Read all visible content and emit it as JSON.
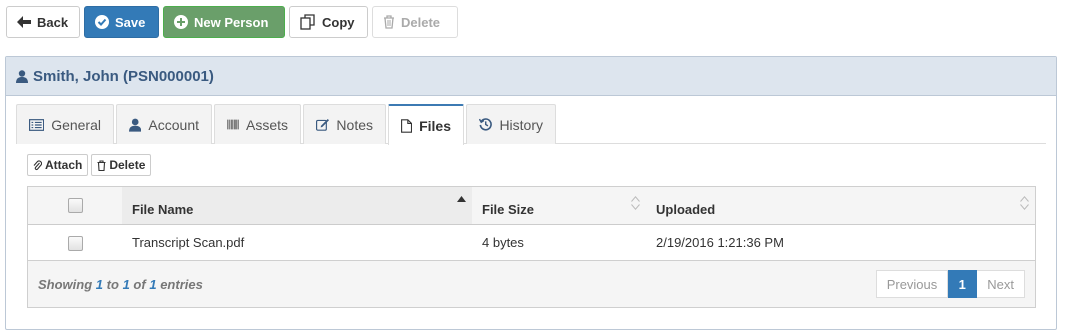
{
  "toolbar": {
    "back_label": "Back",
    "save_label": "Save",
    "new_person_label": "New Person",
    "copy_label": "Copy",
    "delete_label": "Delete"
  },
  "record": {
    "title": "Smith, John (PSN000001)"
  },
  "tabs": [
    {
      "label": "General",
      "icon": "list-icon"
    },
    {
      "label": "Account",
      "icon": "user-icon"
    },
    {
      "label": "Assets",
      "icon": "barcode-icon"
    },
    {
      "label": "Notes",
      "icon": "edit-icon"
    },
    {
      "label": "Files",
      "icon": "file-icon",
      "active": true
    },
    {
      "label": "History",
      "icon": "history-icon"
    }
  ],
  "files": {
    "attach_label": "Attach",
    "delete_label": "Delete",
    "columns": [
      "File Name",
      "File Size",
      "Uploaded"
    ],
    "sort": {
      "column": "File Name",
      "direction": "asc"
    },
    "rows": [
      {
        "name": "Transcript Scan.pdf",
        "size": "4 bytes",
        "uploaded": "2/19/2016 1:21:36 PM"
      }
    ],
    "info": {
      "prefix": "Showing",
      "from": "1",
      "to_word": "to",
      "to": "1",
      "of_word": "of",
      "total": "1",
      "suffix": "entries"
    },
    "pagination": {
      "previous_label": "Previous",
      "current_page": "1",
      "next_label": "Next"
    }
  },
  "colors": {
    "primary": "#337ab7",
    "success": "#6a9f6a",
    "heading_bg": "#dde5ee",
    "heading_text": "#3a5a80"
  }
}
